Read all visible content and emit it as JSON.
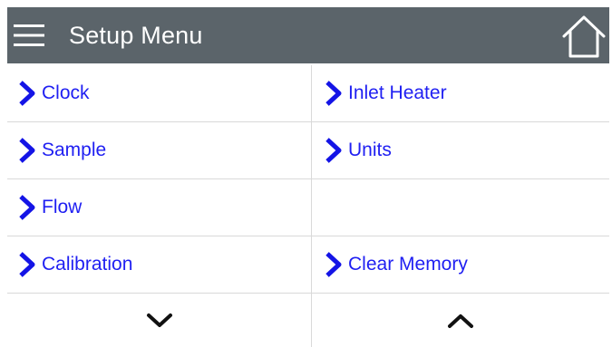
{
  "header": {
    "title": "Setup Menu",
    "menu_icon": "hamburger-menu-icon",
    "home_icon": "home-icon",
    "background": "#5b646a"
  },
  "menu": {
    "items": [
      {
        "label": "Clock"
      },
      {
        "label": "Inlet Heater"
      },
      {
        "label": "Sample"
      },
      {
        "label": "Units"
      },
      {
        "label": "Flow"
      },
      {
        "label": ""
      },
      {
        "label": "Calibration"
      },
      {
        "label": "Clear Memory"
      }
    ],
    "item_icon": "chevron-right-icon",
    "link_color": "#1f1ff2"
  },
  "pager": {
    "down_icon": "chevron-down-icon",
    "up_icon": "chevron-up-icon"
  }
}
